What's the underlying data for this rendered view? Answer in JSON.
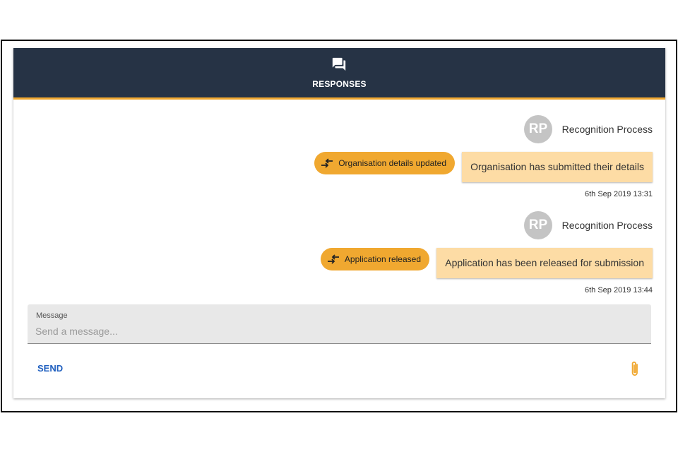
{
  "header": {
    "title": "RESPONSES",
    "icon": "forum-icon"
  },
  "messages": [
    {
      "avatar_initials": "RP",
      "sender": "Recognition Process",
      "tag": "Organisation details updated",
      "text": "Organisation has submitted their details",
      "timestamp": "6th Sep 2019 13:31"
    },
    {
      "avatar_initials": "RP",
      "sender": "Recognition Process",
      "tag": "Application released",
      "text": "Application has been released for submission",
      "timestamp": "6th Sep 2019 13:44"
    }
  ],
  "composer": {
    "label": "Message",
    "placeholder": "Send a message...",
    "value": "",
    "send_label": "SEND",
    "attach_icon": "paperclip-icon"
  },
  "colors": {
    "header_bg": "#263345",
    "accent": "#f0a830",
    "bubble_bg": "#fddca5",
    "send": "#1f5fbf"
  }
}
